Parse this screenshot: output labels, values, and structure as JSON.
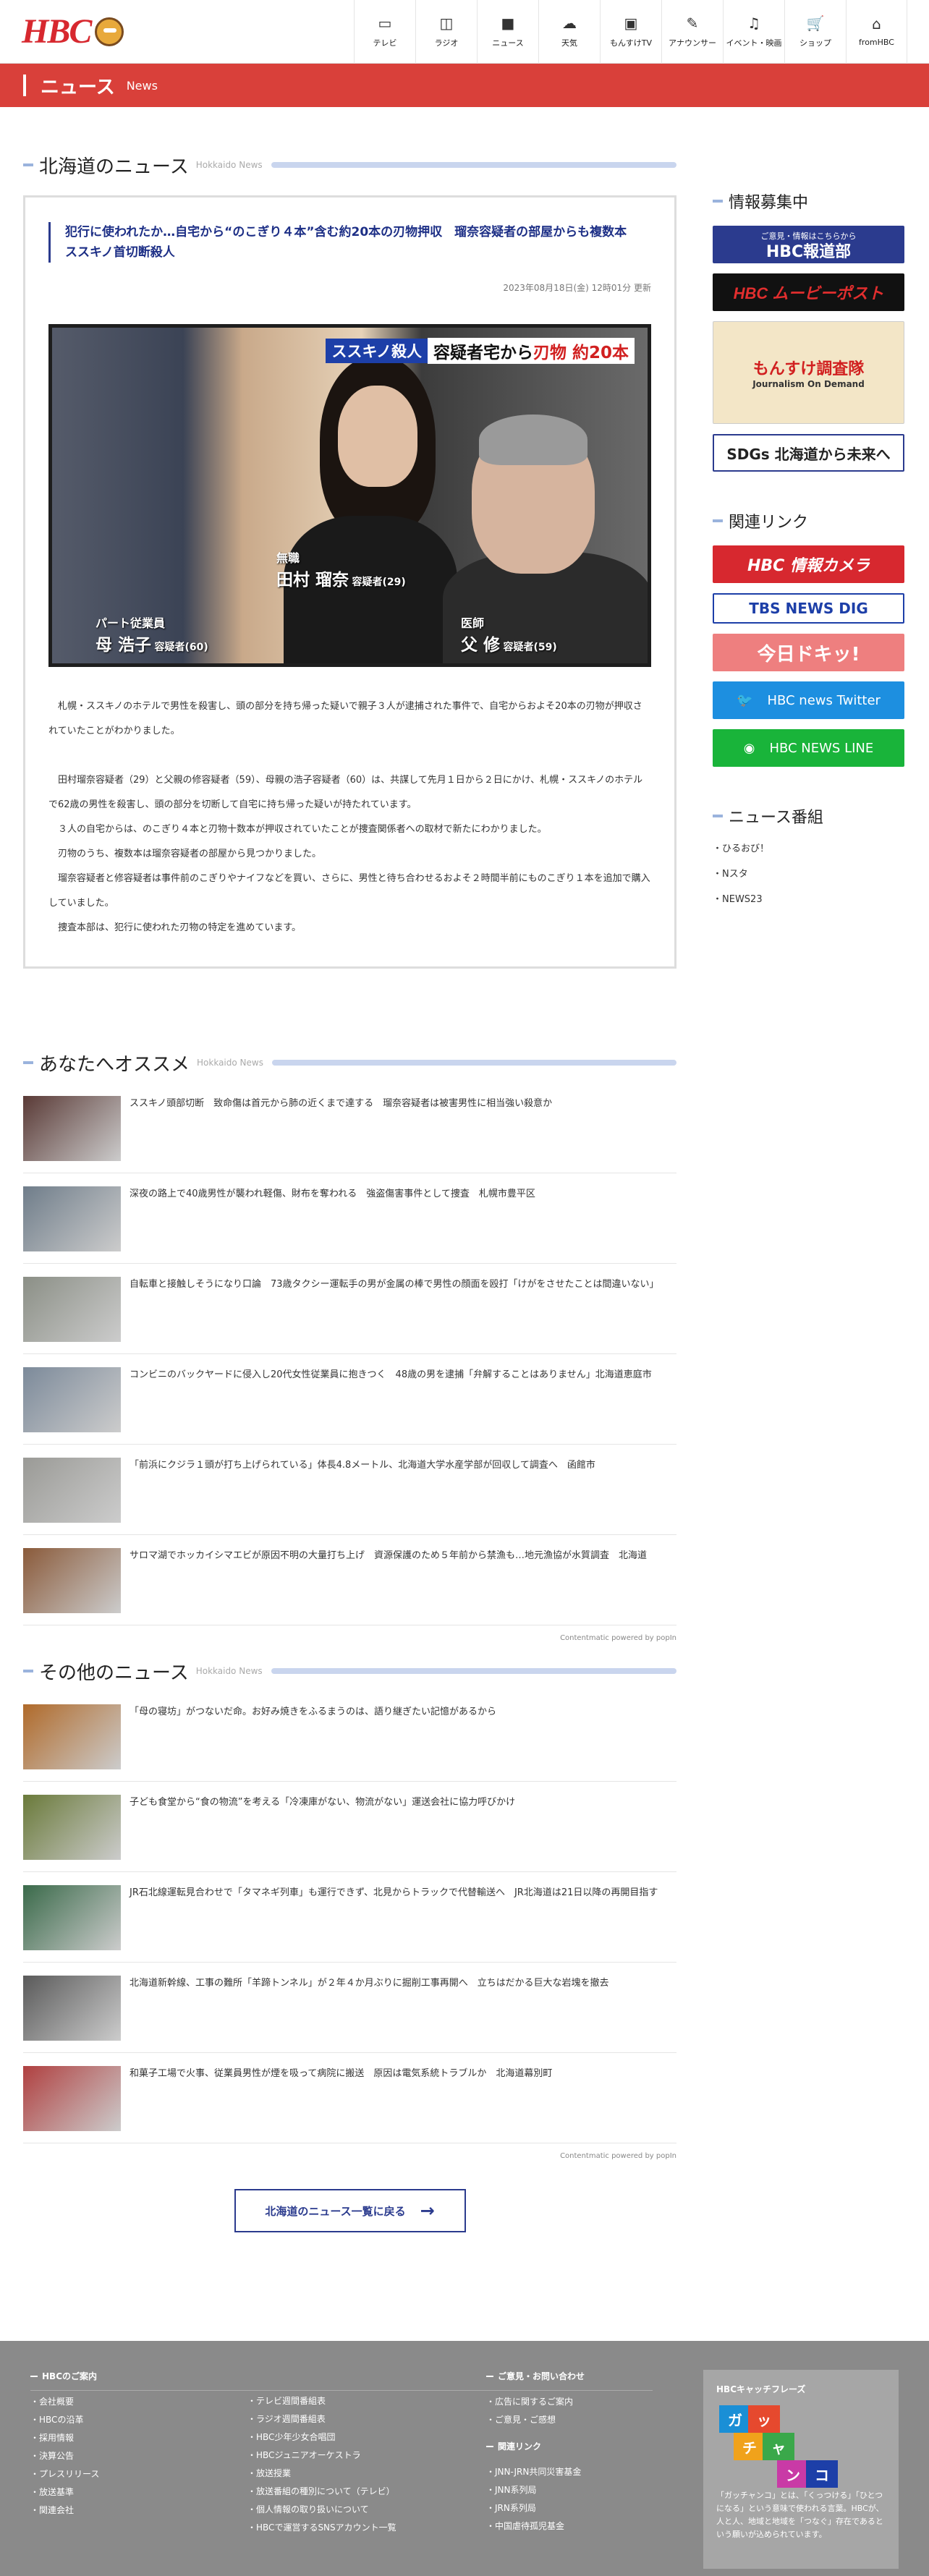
{
  "header": {
    "logo": "HBC",
    "nav": [
      {
        "label": "テレビ",
        "icon": "tv-icon",
        "glyph": "▭"
      },
      {
        "label": "ラジオ",
        "icon": "radio-icon",
        "glyph": "◫"
      },
      {
        "label": "ニュース",
        "icon": "camera-icon",
        "glyph": "■"
      },
      {
        "label": "天気",
        "icon": "weather-icon",
        "glyph": "☁"
      },
      {
        "label": "もんすけTV",
        "icon": "video-icon",
        "glyph": "▣"
      },
      {
        "label": "アナウンサー",
        "icon": "mic-icon",
        "glyph": "✎"
      },
      {
        "label": "イベント・映画",
        "icon": "music-icon",
        "glyph": "♫"
      },
      {
        "label": "ショップ",
        "icon": "cart-icon",
        "glyph": "🛒"
      },
      {
        "label": "fromHBC",
        "icon": "building-icon",
        "glyph": "⌂"
      }
    ]
  },
  "banner": {
    "title": "ニュース",
    "sub": "News"
  },
  "hokkaido": {
    "title": "北海道のニュース",
    "en": "Hokkaido News"
  },
  "article": {
    "title": "犯行に使われたか…自宅から“のこぎり４本”含む約20本の刃物押収　瑠奈容疑者の部屋からも複数本　ススキノ首切断殺人",
    "date": "2023年08月18日(金) 12時01分 更新",
    "photo": {
      "tag": "ススキノ殺人",
      "head_a": "容疑者宅から",
      "head_b": "刃物 約20本",
      "p1_role": "無職",
      "p1_name": "田村 瑠奈",
      "p1_sfx": "容疑者(29)",
      "p2_role": "パート従業員",
      "p2_name": "母 浩子",
      "p2_sfx": "容疑者(60)",
      "p3_role": "医師",
      "p3_name": "父 修",
      "p3_sfx": "容疑者(59)"
    },
    "paragraphs": [
      "　札幌・ススキノのホテルで男性を殺害し、頭の部分を持ち帰った疑いで親子３人が逮捕された事件で、自宅からおよそ20本の刃物が押収されていたことがわかりました。",
      "",
      "　田村瑠奈容疑者（29）と父親の修容疑者（59）、母親の浩子容疑者（60）は、共謀して先月１日から２日にかけ、札幌・ススキノのホテルで62歳の男性を殺害し、頭の部分を切断して自宅に持ち帰った疑いが持たれています。",
      "　３人の自宅からは、のこぎり４本と刃物十数本が押収されていたことが捜査関係者への取材で新たにわかりました。",
      "　刃物のうち、複数本は瑠奈容疑者の部屋から見つかりました。",
      "　瑠奈容疑者と修容疑者は事件前のこぎりやナイフなどを買い、さらに、男性と待ち合わせるおよそ２時間半前にものこぎり１本を追加で購入していました。",
      "　捜査本部は、犯行に使われた刃物の特定を進めています。"
    ]
  },
  "recommend": {
    "title": "あなたへオススメ",
    "en": "Hokkaido News",
    "items": [
      {
        "text": "ススキノ頭部切断　致命傷は首元から肺の近くまで達する　瑠奈容疑者は被害男性に相当強い殺意か",
        "color": "#5a3a36"
      },
      {
        "text": "深夜の路上で40歳男性が襲われ軽傷、財布を奪われる　強盗傷害事件として捜査　札幌市豊平区",
        "color": "#6f7d8a"
      },
      {
        "text": "自転車と接触しそうになり口論　73歳タクシー運転手の男が金属の棒で男性の顔面を殴打「けがをさせたことは間違いない」",
        "color": "#8b8f86"
      },
      {
        "text": "コンビニのバックヤードに侵入し20代女性従業員に抱きつく　48歳の男を逮捕「弁解することはありません」北海道恵庭市",
        "color": "#7c8a9a"
      },
      {
        "text": "「前浜にクジラ１頭が打ち上げられている」体長4.8メートル、北海道大学水産学部が回収して調査へ　函館市",
        "color": "#9a9a96"
      },
      {
        "text": "サロマ湖でホッカイシマエビが原因不明の大量打ち上げ　資源保護のため５年前から禁漁も…地元漁協が水質調査　北海道",
        "color": "#8a5a3a"
      }
    ],
    "powered": "Contentmatic powered by popIn"
  },
  "others": {
    "title": "その他のニュース",
    "en": "Hokkaido News",
    "items": [
      {
        "text": "「母の寝坊」がつないだ命。お好み焼きをふるまうのは、語り継ぎたい記憶があるから",
        "color": "#b06a2a"
      },
      {
        "text": "子ども食堂から“食の物流”を考える「冷凍庫がない、物流がない」運送会社に協力呼びかけ",
        "color": "#6a7a3a"
      },
      {
        "text": "JR石北線運転見合わせで「タマネギ列車」も運行できず、北見からトラックで代替輸送へ　JR北海道は21日以降の再開目指す",
        "color": "#3a6a4a"
      },
      {
        "text": "北海道新幹線、工事の難所「羊蹄トンネル」が２年４か月ぶりに掘削工事再開へ　立ちはだかる巨大な岩塊を撤去",
        "color": "#5a5a5a"
      },
      {
        "text": "和菓子工場で火事、従業員男性が煙を吸って病院に搬送　原因は電気系統トラブルか　北海道幕別町",
        "color": "#b04040"
      }
    ],
    "powered": "Contentmatic powered by popIn"
  },
  "back_button": "北海道のニュース一覧に戻る",
  "sidebar": {
    "info_title": "情報募集中",
    "hodo_small": "ご意見・情報はこちらから",
    "hodo": "HBC報道部",
    "movie": "HBC ムービーポスト",
    "chosa": "もんすけ調査隊",
    "chosa_small": "Journalism On Demand",
    "sdgs": "SDGs 北海道から未来へ",
    "links_title": "関連リンク",
    "camera": "HBC 情報カメラ",
    "tbs": "TBS NEWS DIG",
    "doki": "今日ドキッ!",
    "twitter": "HBC news Twitter",
    "line": "HBC NEWS LINE",
    "programs_title": "ニュース番組",
    "programs": [
      "ひるおび！",
      "Nスタ",
      "NEWS23"
    ]
  },
  "footer": {
    "guide_title": "HBCのご案内",
    "guide": [
      "会社概要",
      "HBCの沿革",
      "採用情報",
      "決算公告",
      "プレスリリース",
      "放送基準",
      "関連会社"
    ],
    "guide2": [
      "テレビ週間番組表",
      "ラジオ週間番組表",
      "HBC少年少女合唱団",
      "HBCジュニアオーケストラ",
      "放送授業",
      "放送番組の種別について（テレビ）",
      "個人情報の取り扱いについて",
      "HBCで運営するSNSアカウント一覧"
    ],
    "contact_title": "ご意見・お問い合わせ",
    "contact": [
      "広告に関するご案内",
      "ご意見・ご感想"
    ],
    "links_title": "関連リンク",
    "links": [
      "JNN-JRN共同災害基金",
      "JNN系列局",
      "JRN系列局",
      "中国虐待孤児基金"
    ],
    "catch_title": "HBCキャッチフレーズ",
    "catch_chars": [
      "ガ",
      "ッ",
      "チ",
      "ャ",
      "ン",
      "コ"
    ],
    "catch_text": "「ガッチャンコ」とは、「くっつける」「ひとつになる」という意味で使われる言葉。HBCが、人と人、地域と地域を「つなぐ」存在であるという願いが込められています。"
  }
}
